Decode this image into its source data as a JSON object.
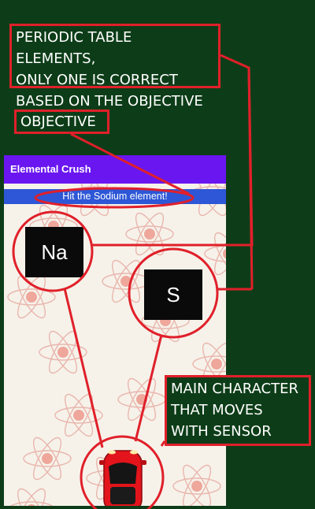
{
  "annotations": {
    "elements_callout": [
      "PERIODIC TABLE ELEMENTS,",
      "ONLY ONE IS CORRECT",
      "BASED ON THE OBJECTIVE"
    ],
    "objective_callout": "OBJECTIVE",
    "character_callout": [
      "MAIN CHARACTER",
      "THAT MOVES",
      "WITH SENSOR"
    ]
  },
  "app": {
    "title": "Elemental Crush",
    "objective_text": "Hit the Sodium element!"
  },
  "elements": [
    {
      "symbol": "Na"
    },
    {
      "symbol": "S"
    }
  ],
  "colors": {
    "background": "#0d3d18",
    "annotation_red": "#e0202a",
    "appbar_purple": "#6a16f0",
    "objective_blue": "#2d57d6",
    "car_red": "#e3141b"
  },
  "icons": [
    "atom-icon",
    "car-icon"
  ]
}
